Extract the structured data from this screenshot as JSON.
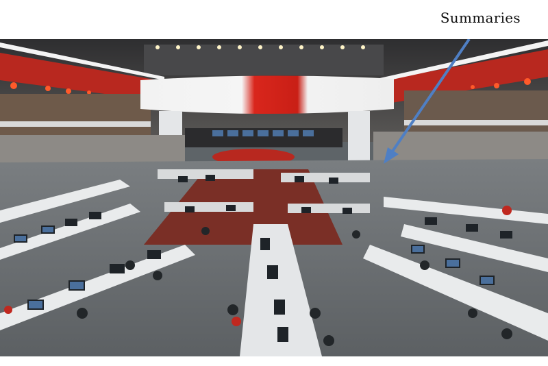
{
  "page": {
    "heading": "Summaries"
  },
  "photo": {
    "subject": "newsroom-photo",
    "accent_red": "#d9261c",
    "ceiling_dark": "#3a3a3c",
    "floor_grey": "#6b7074",
    "desk_white": "#e9ebec",
    "carpet_red": "#7a2f26",
    "screen_blue": "#4a6f9c",
    "arrow_blue": "#4f7fc4"
  }
}
